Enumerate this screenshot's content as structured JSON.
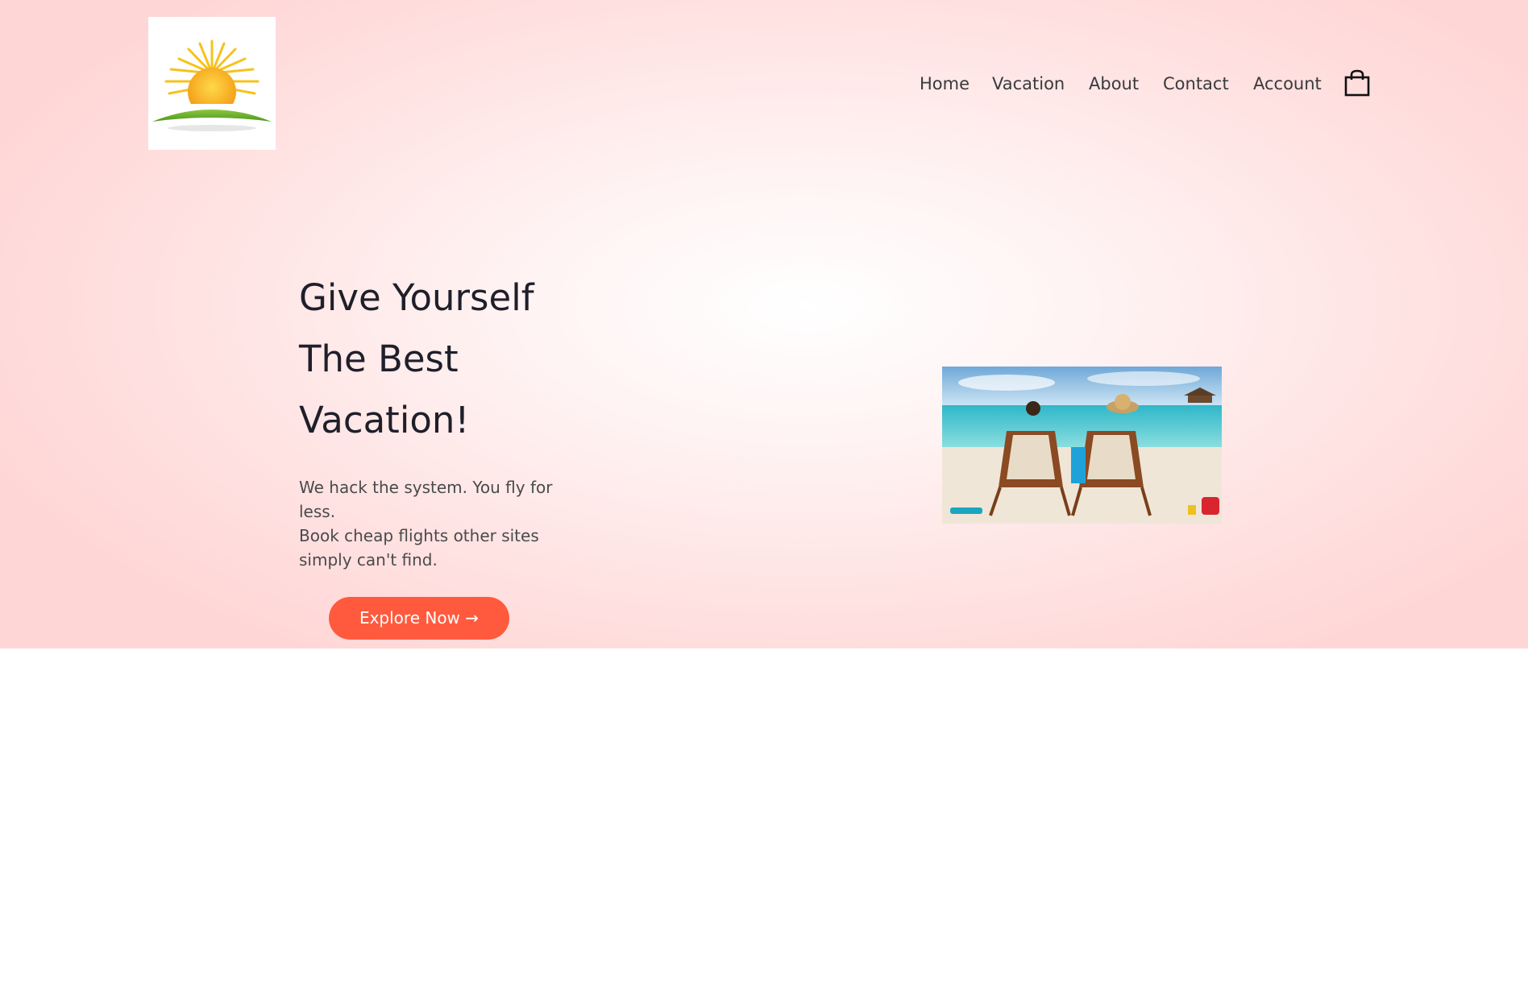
{
  "nav": {
    "items": [
      {
        "label": "Home"
      },
      {
        "label": "Vacation"
      },
      {
        "label": "About"
      },
      {
        "label": "Contact"
      },
      {
        "label": "Account"
      }
    ],
    "cart_icon": "shopping-bag-icon"
  },
  "logo": {
    "icon": "sunrise-logo"
  },
  "hero": {
    "headline_lines": [
      "Give Yourself",
      "The Best",
      "Vacation!"
    ],
    "subtext_lines": [
      "We hack the system. You fly for",
      "less.",
      "Book cheap flights other sites",
      "simply can't find."
    ],
    "cta_label": "Explore Now →",
    "image": "beach-loungers-photo"
  },
  "colors": {
    "accent": "#ff5a3d",
    "hero_bg": "#ffdada",
    "text": "#1f1f2a"
  }
}
